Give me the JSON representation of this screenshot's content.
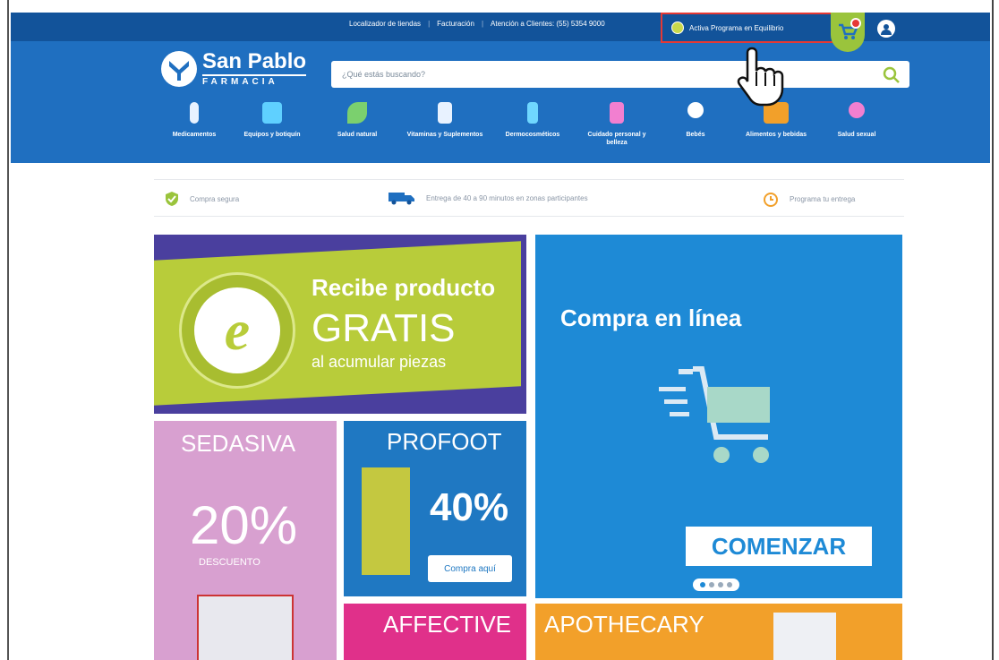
{
  "topbar": {
    "links": [
      "Localizador de tiendas",
      "Facturación",
      "Atención a Clientes: (55) 5354 9000"
    ],
    "promo_label": "Activa Programa en Equilibrio"
  },
  "logo": {
    "main": "San Pablo",
    "sub": "FARMACIA"
  },
  "search": {
    "placeholder": "¿Qué estás buscando?"
  },
  "categories": [
    {
      "label": "Medicamentos",
      "color": "#e8f2ff"
    },
    {
      "label": "Equipos y botiquín",
      "color": "#5fd0ff"
    },
    {
      "label": "Salud natural",
      "color": "#7bd06e"
    },
    {
      "label": "Vitaminas y Suplementos",
      "color": "#e8f2ff"
    },
    {
      "label": "Dermocosméticos",
      "color": "#6fd7ff"
    },
    {
      "label": "Cuidado personal y belleza",
      "color": "#f27fd0"
    },
    {
      "label": "Bebés",
      "color": "#ffffff"
    },
    {
      "label": "Alimentos y bebidas",
      "color": "#f2a02a"
    },
    {
      "label": "Salud sexual",
      "color": "#f27fd0"
    }
  ],
  "features": [
    {
      "label": "Compra segura"
    },
    {
      "label": "Entrega de 40 a 90 minutos en zonas participantes"
    },
    {
      "label": "Programa tu entrega"
    }
  ],
  "banners": {
    "green": {
      "line1": "Recibe producto",
      "line2": "GRATIS",
      "line3": "al acumular piezas",
      "badge": "e"
    },
    "blue": {
      "title": "Compra en línea",
      "cta": "COMENZAR"
    },
    "pink": {
      "brand": "SEDASIVA",
      "pct": "20%",
      "off": "DESCUENTO"
    },
    "profoot": {
      "brand": "PROFOOT",
      "pct": "40%",
      "cta": "Compra aquí"
    },
    "affective": {
      "brand": "AFFECTIVE"
    },
    "apothecary": {
      "brand": "APOTHECARY"
    }
  },
  "colors": {
    "header": "#1f6fc0",
    "topbar": "#12539a",
    "highlight": "#e53935"
  }
}
